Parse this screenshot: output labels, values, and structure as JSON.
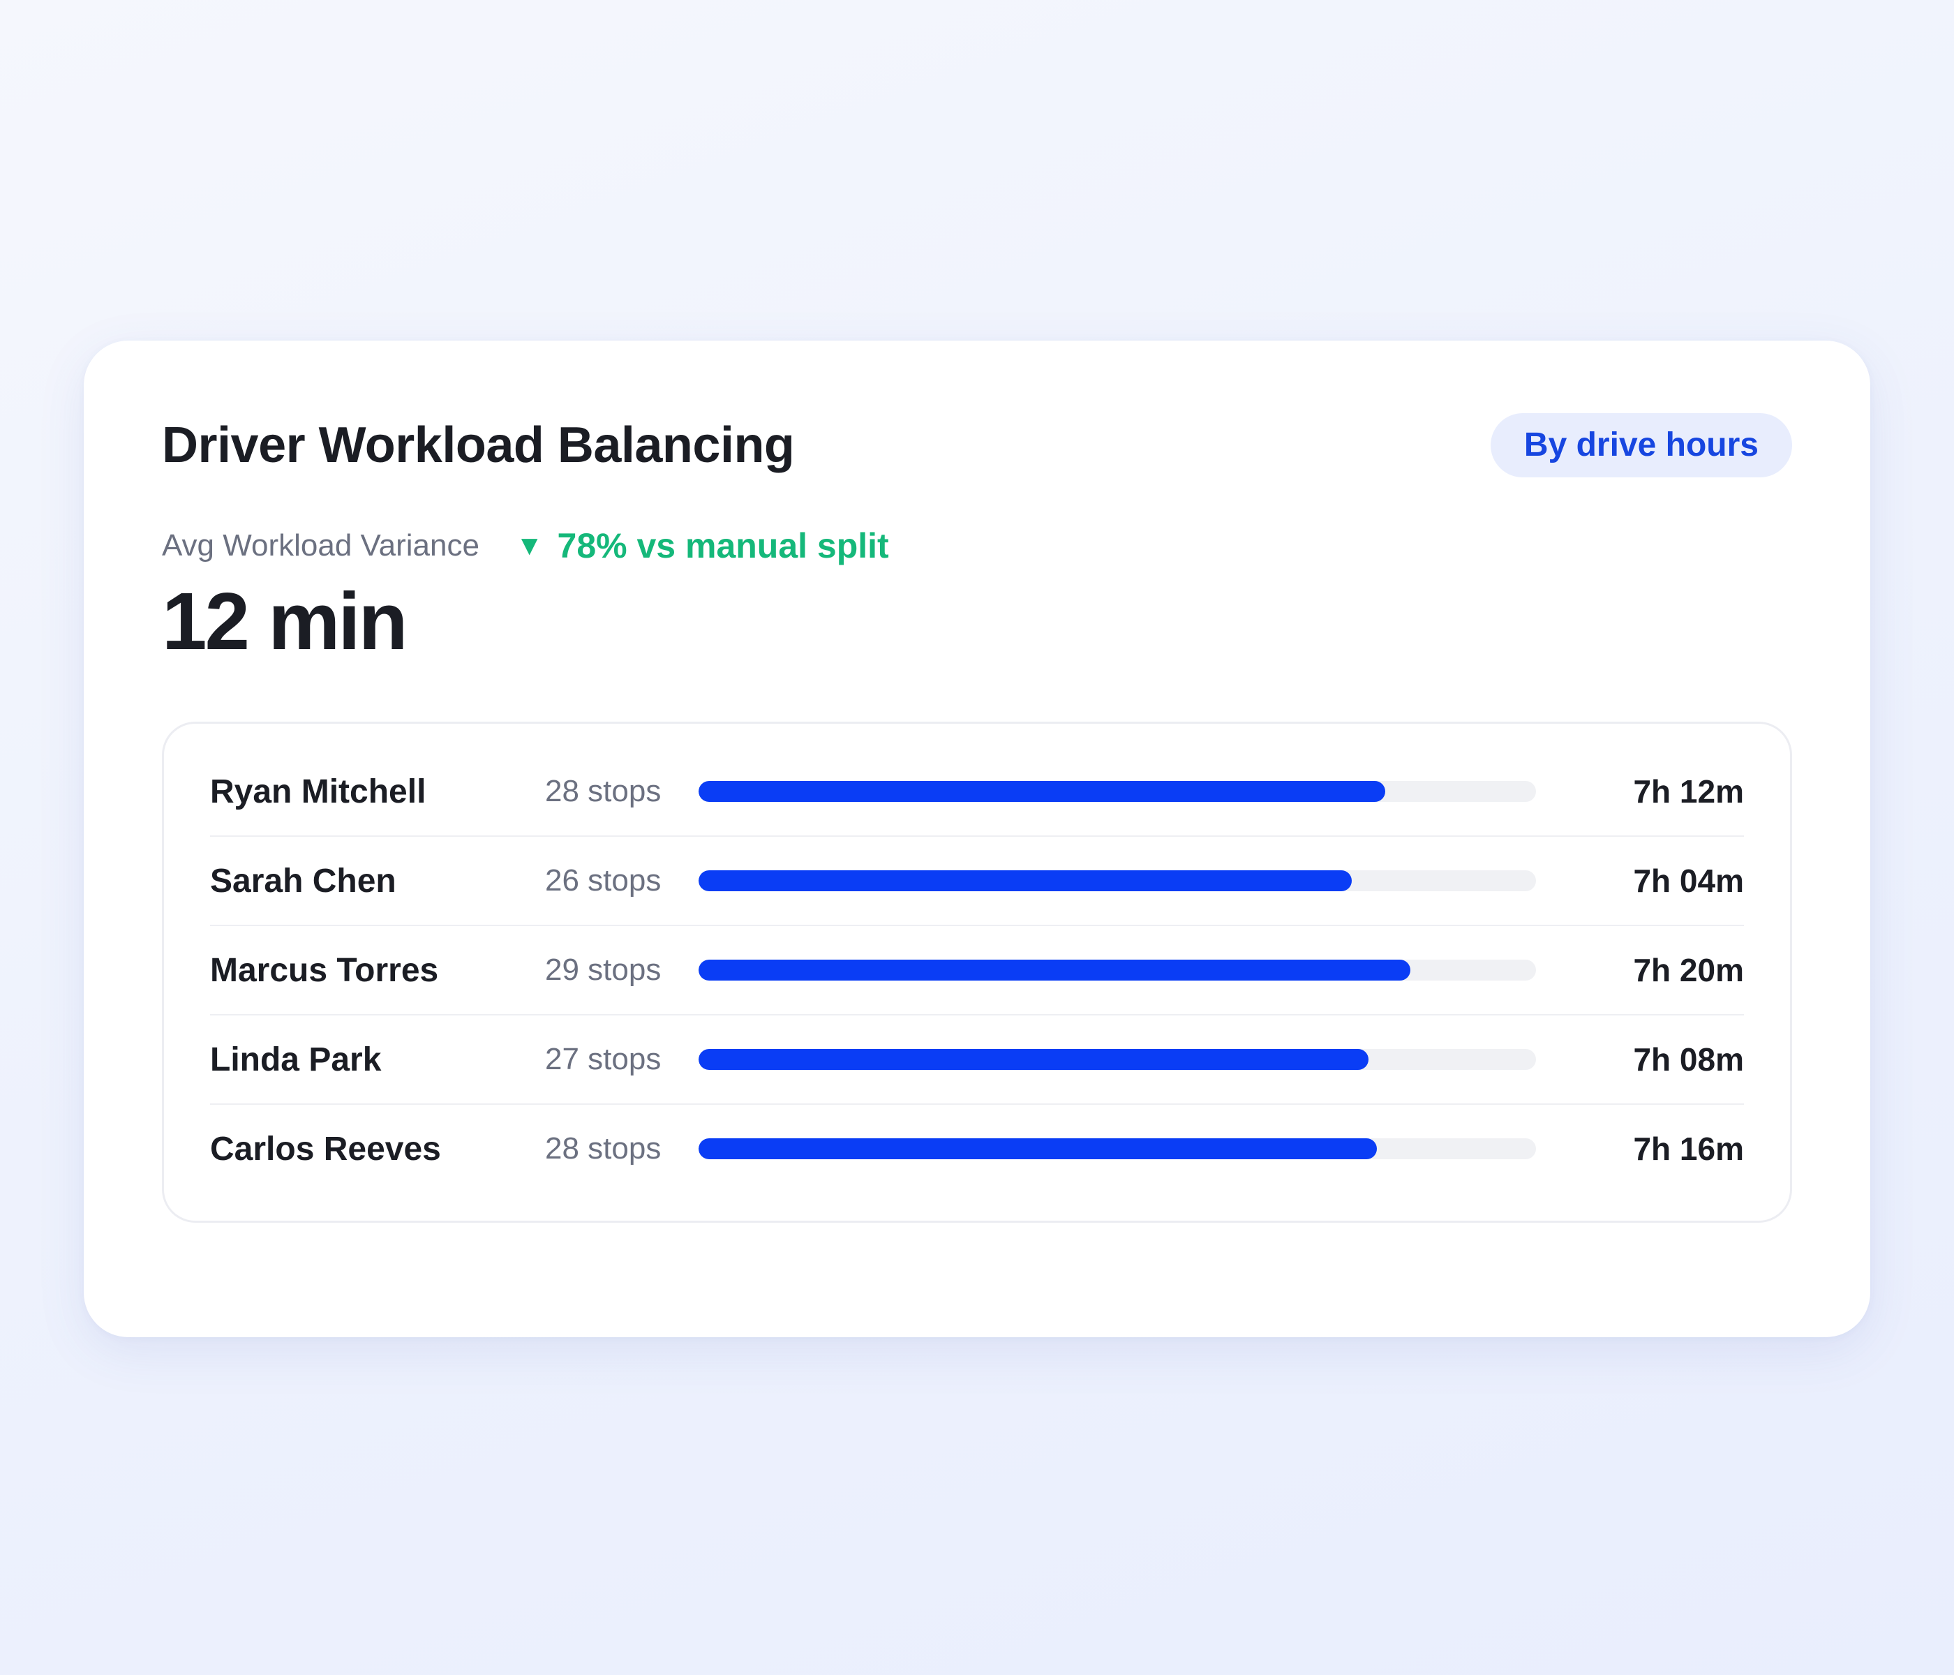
{
  "card": {
    "title": "Driver Workload Balancing",
    "filter_label": "By drive hours"
  },
  "metric": {
    "label": "Avg Workload Variance",
    "trend_icon": "▼",
    "trend_text": "78% vs manual split",
    "value": "12 min"
  },
  "colors": {
    "accent": "#0a3df5",
    "trend_positive": "#15b87a",
    "pill_bg": "#e8edfd",
    "pill_text": "#1746e0"
  },
  "drivers": [
    {
      "name": "Ryan Mitchell",
      "stops": "28 stops",
      "hours": "7h 12m",
      "fill_fraction": 0.82
    },
    {
      "name": "Sarah Chen",
      "stops": "26 stops",
      "hours": "7h 04m",
      "fill_fraction": 0.78
    },
    {
      "name": "Marcus Torres",
      "stops": "29 stops",
      "hours": "7h 20m",
      "fill_fraction": 0.85
    },
    {
      "name": "Linda Park",
      "stops": "27 stops",
      "hours": "7h 08m",
      "fill_fraction": 0.8
    },
    {
      "name": "Carlos Reeves",
      "stops": "28 stops",
      "hours": "7h 16m",
      "fill_fraction": 0.81
    }
  ]
}
